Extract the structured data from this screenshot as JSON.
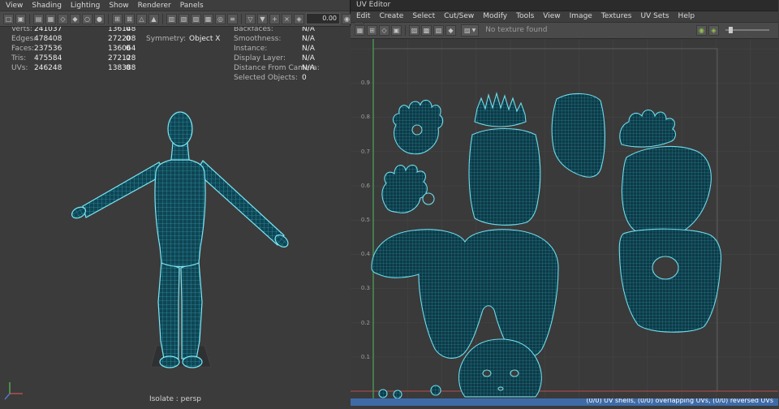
{
  "left_panel": {
    "menu": [
      "View",
      "Shading",
      "Lighting",
      "Show",
      "Renderer",
      "Panels"
    ],
    "toolbar": {
      "icons": [
        {
          "name": "select-tool-icon",
          "glyph": "□"
        },
        {
          "name": "component-select-icon",
          "glyph": "▣"
        },
        {
          "sep": true
        },
        {
          "name": "grid-display-icon",
          "glyph": "▤"
        },
        {
          "name": "snap-grid-icon",
          "glyph": "▦"
        },
        {
          "name": "snap-curve-icon",
          "glyph": "◇"
        },
        {
          "name": "snap-point-icon",
          "glyph": "◆"
        },
        {
          "name": "snap-view-icon",
          "glyph": "○"
        },
        {
          "name": "make-live-icon",
          "glyph": "●"
        },
        {
          "sep": true
        },
        {
          "name": "camera-attributes-icon",
          "glyph": "⊞"
        },
        {
          "name": "bookmarks-icon",
          "glyph": "⊠"
        },
        {
          "name": "image-plane-icon",
          "glyph": "△"
        },
        {
          "name": "two-d-pan-zoom-icon",
          "glyph": "▲"
        },
        {
          "sep": true
        },
        {
          "name": "film-gate-icon",
          "glyph": "▥"
        },
        {
          "name": "resolution-gate-icon",
          "glyph": "▧"
        },
        {
          "name": "gate-mask-icon",
          "glyph": "▨"
        },
        {
          "name": "field-chart-icon",
          "glyph": "▩"
        },
        {
          "name": "safe-action-icon",
          "glyph": "◎"
        },
        {
          "name": "safe-title-icon",
          "glyph": "≡"
        },
        {
          "sep": true
        },
        {
          "name": "wireframe-mode-icon",
          "glyph": "▽"
        },
        {
          "name": "shaded-mode-icon",
          "glyph": "▼"
        },
        {
          "name": "textured-mode-icon",
          "glyph": "+"
        },
        {
          "name": "lighting-mode-icon",
          "glyph": "×"
        },
        {
          "name": "xray-mode-icon",
          "glyph": "◈"
        }
      ],
      "field_value": "0.00",
      "icons_after": [
        {
          "name": "isolate-select-icon",
          "glyph": "◉"
        },
        {
          "name": "grease-pencil-icon",
          "glyph": "✎"
        }
      ]
    },
    "hud": {
      "rows": [
        {
          "label": "Verts:",
          "c1": "241037",
          "c2": "136148",
          "c3": "0"
        },
        {
          "label": "Edges:",
          "c1": "478408",
          "c2": "272208",
          "c3": "0"
        },
        {
          "label": "Faces:",
          "c1": "237536",
          "c2": "136064",
          "c3": "0"
        },
        {
          "label": "Tris:",
          "c1": "475584",
          "c2": "272128",
          "c3": "0"
        },
        {
          "label": "UVs:",
          "c1": "246248",
          "c2": "138388",
          "c3": "0"
        }
      ],
      "symmetry": {
        "label": "Symmetry:",
        "value": "Object X"
      },
      "right_rows": [
        {
          "label": "Backfaces:",
          "value": "N/A"
        },
        {
          "label": "Smoothness:",
          "value": "N/A"
        },
        {
          "label": "Instance:",
          "value": "N/A"
        },
        {
          "label": "Display Layer:",
          "value": "N/A"
        },
        {
          "label": "Distance From Camera:",
          "value": "N/A"
        },
        {
          "label": "Selected Objects:",
          "value": "0"
        }
      ]
    },
    "isolate_label": "Isolate : persp"
  },
  "uv_editor": {
    "title": "UV Editor",
    "menu": [
      "Edit",
      "Create",
      "Select",
      "Cut/Sew",
      "Modify",
      "Tools",
      "View",
      "Image",
      "Textures",
      "UV Sets",
      "Help"
    ],
    "toolbar": {
      "icons_left": [
        {
          "name": "uv-lattice-tool-icon",
          "glyph": "▦"
        },
        {
          "name": "uv-move-sew-icon",
          "glyph": "⊞"
        },
        {
          "name": "uv-optimize-icon",
          "glyph": "◇"
        },
        {
          "name": "uv-layout-icon",
          "glyph": "▣"
        },
        {
          "sep": true
        },
        {
          "name": "uv-shade-icon",
          "glyph": "▨"
        },
        {
          "name": "uv-borders-icon",
          "glyph": "▩"
        },
        {
          "name": "uv-checker-icon",
          "glyph": "▧"
        },
        {
          "name": "uv-distortion-icon",
          "glyph": "◆"
        }
      ],
      "texture": {
        "glyph": "▨",
        "arrow": "▼",
        "label": "No texture found"
      },
      "icons_right": [
        {
          "name": "bake-editor-texture-icon",
          "glyph": "◉",
          "color": "#8fc34a"
        },
        {
          "name": "refresh-image-icon",
          "glyph": "◈",
          "color": "#8fc34a"
        }
      ]
    },
    "axis_labels": [
      "0.1",
      "0.2",
      "0.3",
      "0.4",
      "0.5",
      "0.6",
      "0.7",
      "0.8",
      "0.9"
    ],
    "status": "(0/0) UV shells, (0/0) overlapping UVs, (0/0) reversed UVs"
  },
  "colors": {
    "wireframe": "#6fdcec",
    "status_bar": "#3e6ba8",
    "uv_axis_green": "#4a9e55",
    "uv_axis_red": "#9e4a4a",
    "viewport_bg": "#3b3b3b"
  }
}
